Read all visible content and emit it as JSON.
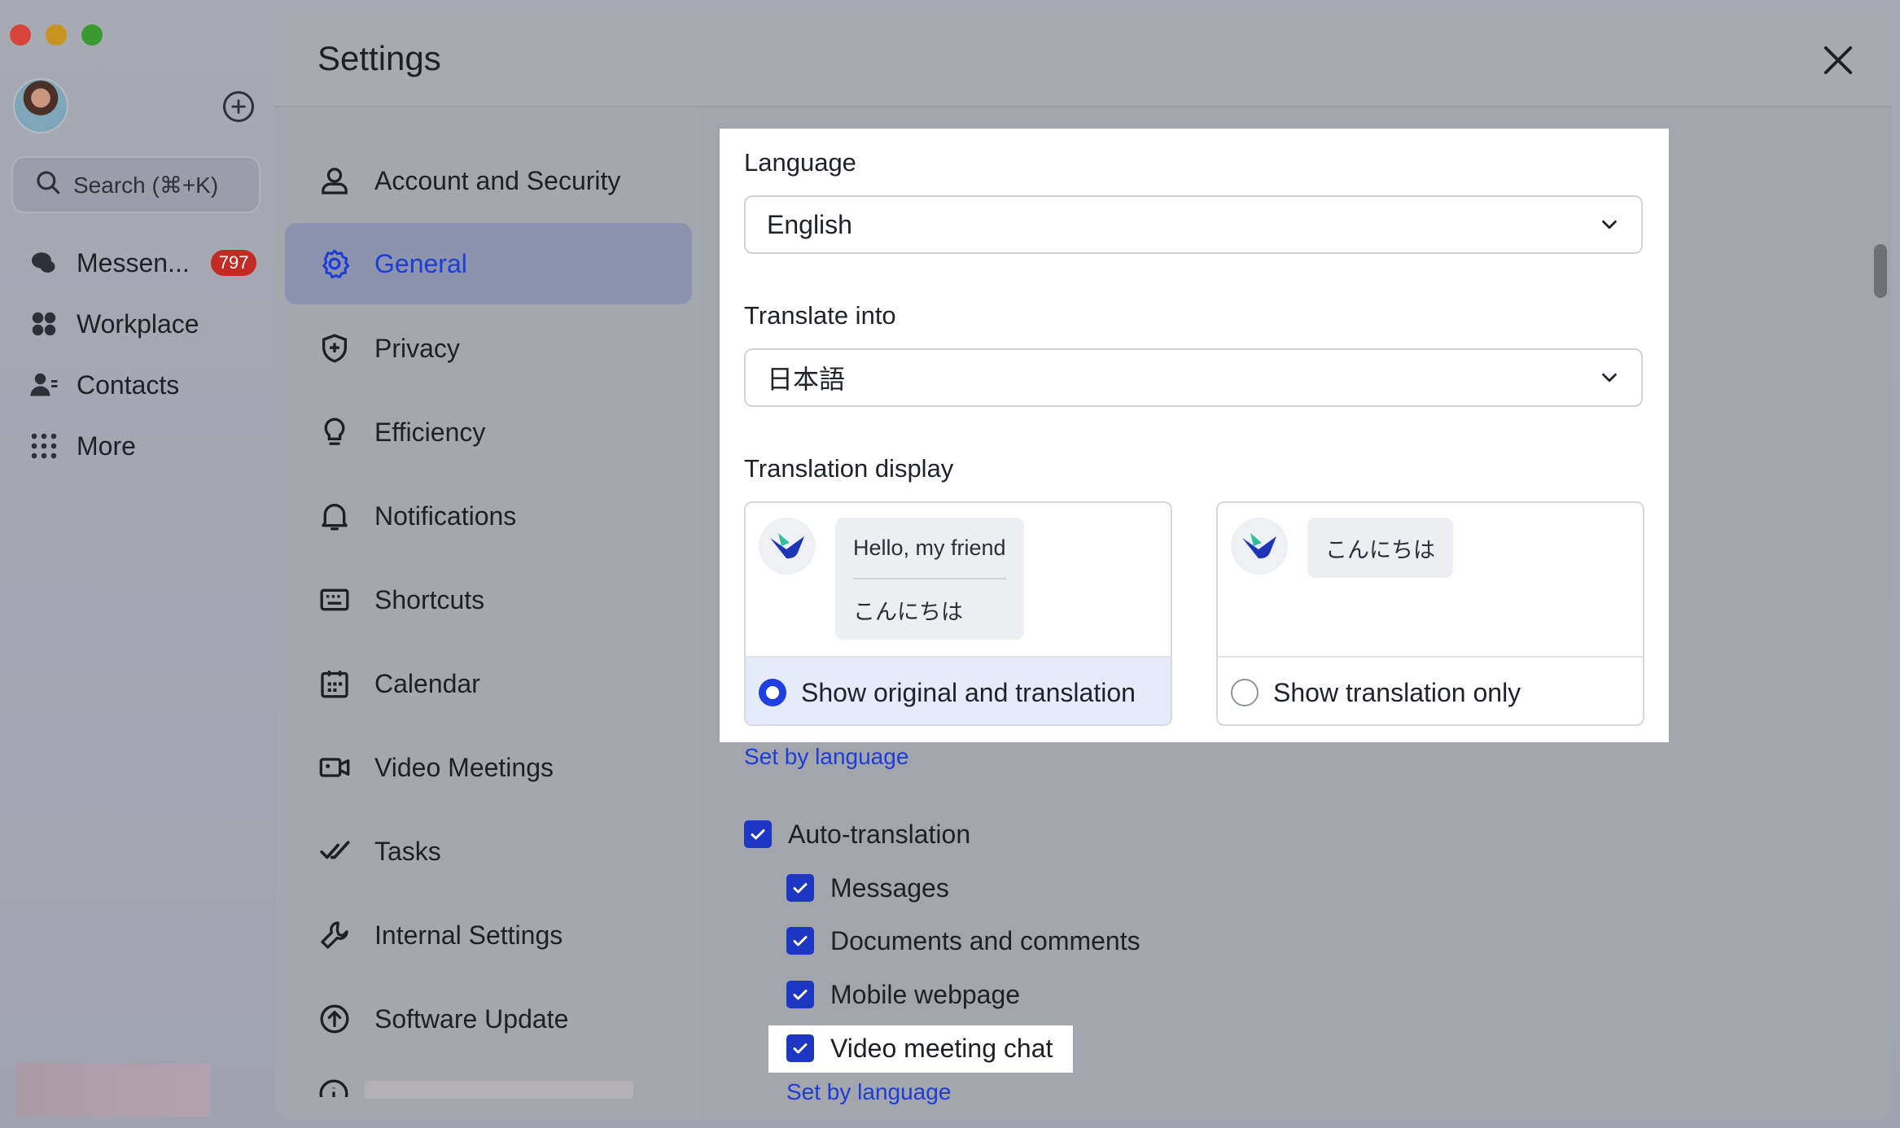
{
  "sidebar": {
    "search_placeholder": "Search (⌘+K)",
    "items": [
      {
        "label": "Messen...",
        "icon": "chat-bubbles-icon",
        "badge": "797"
      },
      {
        "label": "Workplace",
        "icon": "grid-icon"
      },
      {
        "label": "Contacts",
        "icon": "contacts-icon"
      },
      {
        "label": "More",
        "icon": "dots-grid-icon"
      }
    ]
  },
  "settings": {
    "title": "Settings",
    "nav": [
      {
        "label": "Account and Security",
        "icon": "person-icon"
      },
      {
        "label": "General",
        "icon": "gear-icon",
        "active": true
      },
      {
        "label": "Privacy",
        "icon": "shield-icon"
      },
      {
        "label": "Efficiency",
        "icon": "lightbulb-icon"
      },
      {
        "label": "Notifications",
        "icon": "bell-icon"
      },
      {
        "label": "Shortcuts",
        "icon": "keyboard-icon"
      },
      {
        "label": "Calendar",
        "icon": "calendar-icon"
      },
      {
        "label": "Video Meetings",
        "icon": "video-camera-icon"
      },
      {
        "label": "Tasks",
        "icon": "task-check-icon"
      },
      {
        "label": "Internal Settings",
        "icon": "wrench-icon"
      },
      {
        "label": "Software Update",
        "icon": "upload-arrow-icon"
      }
    ]
  },
  "general": {
    "language_label": "Language",
    "language_value": "English",
    "translate_into_label": "Translate into",
    "translate_into_value": "日本語",
    "translation_display_label": "Translation display",
    "option_both": {
      "original_text": "Hello, my friend",
      "translated_text": "こんにちは",
      "label": "Show original and translation",
      "selected": true
    },
    "option_translation_only": {
      "translated_text": "こんにちは",
      "label": "Show translation only",
      "selected": false
    },
    "set_by_language_1": "Set by language",
    "auto_translation": {
      "label": "Auto-translation",
      "checked": true,
      "items": [
        {
          "label": "Messages",
          "checked": true
        },
        {
          "label": "Documents and comments",
          "checked": true
        },
        {
          "label": "Mobile webpage",
          "checked": true
        },
        {
          "label": "Video meeting chat",
          "checked": true
        }
      ]
    },
    "set_by_language_2": "Set by language"
  },
  "colors": {
    "accent": "#1f3fe0",
    "badge": "#c42a24",
    "dim_overlay": "#a8aab0",
    "highlight": "#ffffff"
  }
}
